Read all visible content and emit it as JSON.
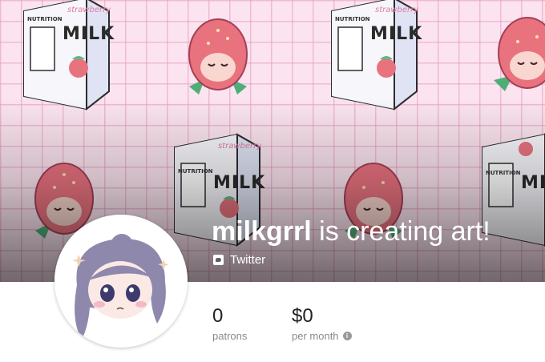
{
  "creator": {
    "name": "milkgrrl",
    "tagline": " is creating art!"
  },
  "social": {
    "icon": "twitter-icon",
    "label": "Twitter"
  },
  "stats": {
    "patrons": {
      "value": "0",
      "label": "patrons"
    },
    "earnings": {
      "value": "$0",
      "label": "per month",
      "info_icon": "info-icon"
    }
  },
  "cover": {
    "carton_word": "MILK",
    "carton_subword": "strawberry",
    "carton_nutrition": "NUTRITION"
  },
  "colors": {
    "grid_background": "#fbe4ef",
    "grid_line": "#e896be",
    "strawberry": "#e9727f",
    "text_on_cover": "#ffffff",
    "stat_label": "#8a8a8a"
  }
}
